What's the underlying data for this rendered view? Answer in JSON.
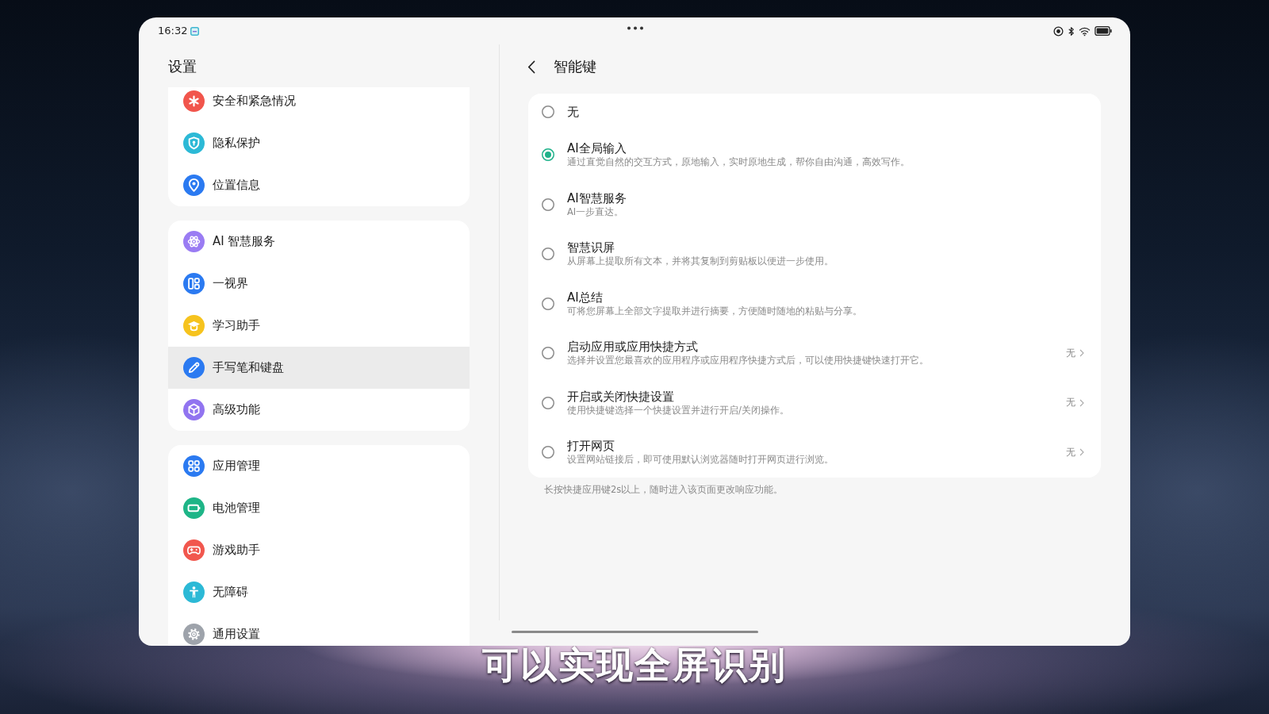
{
  "status_bar": {
    "time": "16:32"
  },
  "sidebar": {
    "title": "设置",
    "groups": [
      {
        "items": [
          {
            "label": "安全和紧急情况",
            "kind": "emergency",
            "selected": false
          },
          {
            "label": "隐私保护",
            "kind": "privacy",
            "selected": false
          },
          {
            "label": "位置信息",
            "kind": "location",
            "selected": false
          }
        ]
      },
      {
        "items": [
          {
            "label": "AI 智慧服务",
            "kind": "ai",
            "selected": false
          },
          {
            "label": "一视界",
            "kind": "vision",
            "selected": false
          },
          {
            "label": "学习助手",
            "kind": "study",
            "selected": false
          },
          {
            "label": "手写笔和键盘",
            "kind": "pen",
            "selected": true
          },
          {
            "label": "高级功能",
            "kind": "advanced",
            "selected": false
          }
        ]
      },
      {
        "items": [
          {
            "label": "应用管理",
            "kind": "apps",
            "selected": false
          },
          {
            "label": "电池管理",
            "kind": "battery",
            "selected": false
          },
          {
            "label": "游戏助手",
            "kind": "game",
            "selected": false
          },
          {
            "label": "无障碍",
            "kind": "accessibility",
            "selected": false
          },
          {
            "label": "通用设置",
            "kind": "general",
            "selected": false
          }
        ]
      }
    ]
  },
  "detail": {
    "title": "智能键",
    "options": [
      {
        "title": "无",
        "selected": false
      },
      {
        "title": "AI全局输入",
        "description": "通过直觉自然的交互方式，原地输入，实时原地生成，帮你自由沟通，高效写作。",
        "selected": true
      },
      {
        "title": "AI智慧服务",
        "description": "AI一步直达。",
        "selected": false
      },
      {
        "title": "智慧识屏",
        "description": "从屏幕上提取所有文本，并将其复制到剪贴板以便进一步使用。",
        "selected": false
      },
      {
        "title": "AI总结",
        "description": "可将您屏幕上全部文字提取并进行摘要，方便随时随地的粘贴与分享。",
        "selected": false
      },
      {
        "title": "启动应用或应用快捷方式",
        "description": "选择并设置您最喜欢的应用程序或应用程序快捷方式后，可以使用快捷键快速打开它。",
        "value": "无",
        "selected": false
      },
      {
        "title": "开启或关闭快捷设置",
        "description": "使用快捷键选择一个快捷设置并进行开启/关闭操作。",
        "value": "无",
        "selected": false
      },
      {
        "title": "打开网页",
        "description": "设置网站链接后，即可使用默认浏览器随时打开网页进行浏览。",
        "value": "无",
        "selected": false
      }
    ],
    "note": "长按快捷应用键2s以上，随时进入该页面更改响应功能。"
  },
  "caption": "可以实现全屏识别"
}
